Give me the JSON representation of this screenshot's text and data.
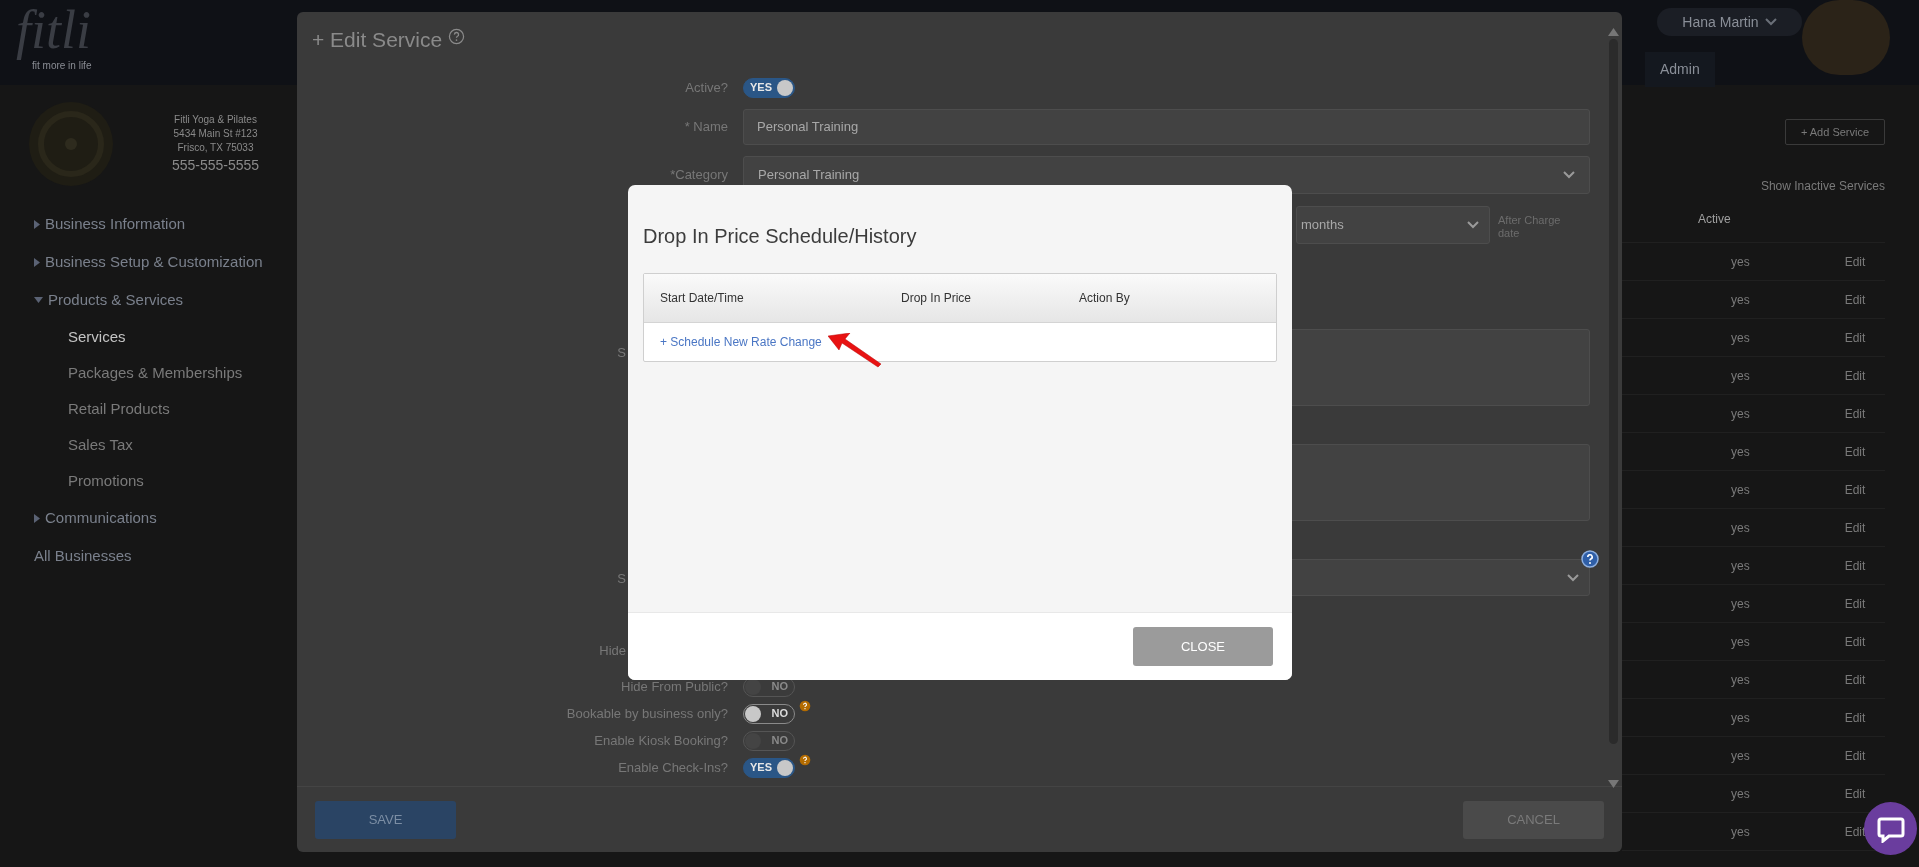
{
  "header": {
    "logo": "fitli",
    "tagline": "fit more in life",
    "user": "Hana Martin",
    "tab": "Admin"
  },
  "business": {
    "name": "Fitli Yoga & Pilates",
    "address": "5434 Main St #123",
    "city": "Frisco, TX 75033",
    "phone": "555-555-5555"
  },
  "sidebar": {
    "items": [
      {
        "label": "Business Information",
        "kind": "group",
        "expanded": false
      },
      {
        "label": "Business Setup & Customization",
        "kind": "group",
        "expanded": false
      },
      {
        "label": "Products & Services",
        "kind": "group",
        "expanded": true,
        "children": [
          {
            "label": "Services",
            "selected": true
          },
          {
            "label": "Packages & Memberships",
            "selected": false
          },
          {
            "label": "Retail Products",
            "selected": false
          },
          {
            "label": "Sales Tax",
            "selected": false
          },
          {
            "label": "Promotions",
            "selected": false
          }
        ]
      },
      {
        "label": "Communications",
        "kind": "group",
        "expanded": false
      },
      {
        "label": "All Businesses",
        "kind": "link"
      }
    ]
  },
  "services": {
    "add_button": "+ Add Service",
    "show_inactive": "Show Inactive Services",
    "columns": [
      "Active"
    ],
    "rows": [
      {
        "active": "yes",
        "action": "Edit"
      },
      {
        "active": "yes",
        "action": "Edit"
      },
      {
        "active": "yes",
        "action": "Edit"
      },
      {
        "active": "yes",
        "action": "Edit"
      },
      {
        "active": "yes",
        "action": "Edit"
      },
      {
        "active": "yes",
        "action": "Edit"
      },
      {
        "active": "yes",
        "action": "Edit"
      },
      {
        "active": "yes",
        "action": "Edit"
      },
      {
        "active": "yes",
        "action": "Edit"
      },
      {
        "active": "yes",
        "action": "Edit"
      },
      {
        "active": "yes",
        "action": "Edit"
      },
      {
        "active": "yes",
        "action": "Edit"
      },
      {
        "active": "yes",
        "action": "Edit"
      },
      {
        "active": "yes",
        "action": "Edit"
      },
      {
        "active": "yes",
        "action": "Edit"
      },
      {
        "active": "yes",
        "action": "Edit"
      }
    ]
  },
  "edit_service": {
    "title": "+ Edit Service",
    "fields": [
      {
        "kind": "toggle",
        "label": "Active?",
        "on": true,
        "text": "YES",
        "disabled": false,
        "help": false
      },
      {
        "kind": "text",
        "label": "* Name",
        "value": "Personal Training"
      },
      {
        "kind": "select",
        "label": "*Category",
        "value": "Personal Training"
      },
      {
        "kind": "partialselect",
        "value": "months",
        "note": "After Charge date"
      },
      {
        "kind": "textarea",
        "label": "S"
      },
      {
        "kind": "textarea"
      },
      {
        "kind": "coveredselect",
        "label": "S",
        "help": true
      },
      {
        "kind": "partiallabel",
        "label": "Hide"
      },
      {
        "kind": "toggle",
        "label": "Hide From Public?",
        "on": false,
        "text": "NO",
        "disabled": true,
        "help": false
      },
      {
        "kind": "toggle",
        "label": "Bookable by business only?",
        "on": false,
        "text": "NO",
        "disabled": false,
        "help": true
      },
      {
        "kind": "toggle",
        "label": "Enable Kiosk Booking?",
        "on": false,
        "text": "NO",
        "disabled": true,
        "help": false
      },
      {
        "kind": "toggle",
        "label": "Enable Check-Ins?",
        "on": true,
        "text": "YES",
        "disabled": false,
        "help": true
      }
    ],
    "save": "SAVE",
    "cancel": "CANCEL"
  },
  "price_modal": {
    "title": "Drop In Price Schedule/History",
    "columns": [
      "Start Date/Time",
      "Drop In Price",
      "Action By"
    ],
    "link": "+ Schedule New Rate Change",
    "close": "CLOSE"
  }
}
